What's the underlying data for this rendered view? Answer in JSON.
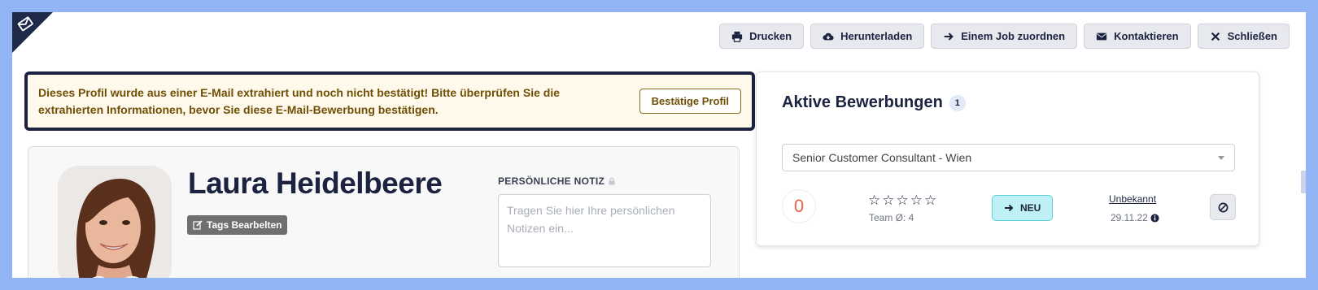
{
  "colors": {
    "background": "#91b4f5",
    "navy": "#1c2340",
    "alert_bg": "#fff9ec",
    "alert_text": "#6f4f05",
    "score": "#e4644c",
    "status_bg": "#bff0f4"
  },
  "toolbar": {
    "buttons": [
      {
        "label": "Drucken",
        "icon": "printer-icon"
      },
      {
        "label": "Herunterladen",
        "icon": "cloud-download-icon"
      },
      {
        "label": "Einem Job zuordnen",
        "icon": "arrow-right-icon"
      },
      {
        "label": "Kontaktieren",
        "icon": "envelope-icon"
      },
      {
        "label": "Schließen",
        "icon": "close-icon"
      }
    ]
  },
  "alert": {
    "text": "Dieses Profil wurde aus einer E-Mail extrahiert und noch nicht bestätigt! Bitte überprüfen Sie die extrahierten Informationen, bevor Sie diese E-Mail-Bewerbung bestätigen.",
    "confirm_label": "Bestätige Profil"
  },
  "profile": {
    "name": "Laura Heidelbeere",
    "tags_label": "Tags Bearbelten",
    "note_label": "PERSÖNLICHE NOTIZ",
    "note_placeholder": "Tragen Sie hier Ihre persönlichen Notizen ein..."
  },
  "applications": {
    "title": "Aktive Bewerbungen",
    "count": "1",
    "selected_job": "Senior Customer Consultant - Wien",
    "score": "0",
    "rating": 0,
    "rating_max": 5,
    "team_avg": "Team Ø: 4",
    "status_label": "NEU",
    "source_label": "Unbekannt",
    "date": "29.11.22"
  }
}
